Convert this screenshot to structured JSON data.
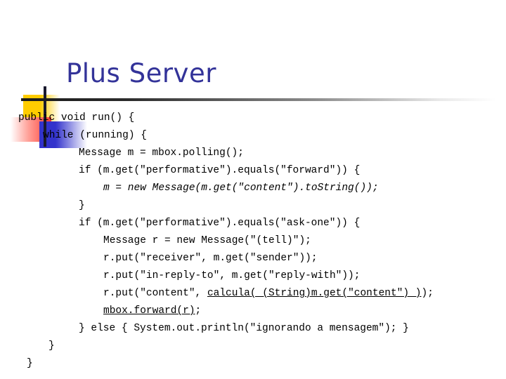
{
  "slide": {
    "title": "Plus Server",
    "title_color": "#333399",
    "background_color": "#ffffff",
    "decoration": {
      "yellow_color": "#FFCC00",
      "blue_color": "#3333CC",
      "red_color": "#FF3B30",
      "line_color": "#1a1a2e"
    }
  },
  "code": {
    "language": "java",
    "lines": [
      {
        "indent": "i0",
        "style": "normal",
        "text": "public void run() {"
      },
      {
        "indent": "i1",
        "style": "normal",
        "text": "while (running) {"
      },
      {
        "indent": "i2",
        "style": "normal",
        "text": "Message m = mbox.polling();"
      },
      {
        "indent": "i2",
        "style": "normal",
        "text": "if (m.get(\"performative\").equals(\"forward\")) {"
      },
      {
        "indent": "i3",
        "style": "italic",
        "text": "m = new Message(m.get(\"content\").toString());"
      },
      {
        "indent": "i2",
        "style": "normal",
        "text": "}"
      },
      {
        "indent": "i2",
        "style": "normal",
        "text": "if (m.get(\"performative\").equals(\"ask-one\")) {"
      },
      {
        "indent": "i3",
        "style": "normal",
        "text": "Message r = new Message(\"(tell)\");"
      },
      {
        "indent": "i3",
        "style": "normal",
        "text": "r.put(\"receiver\", m.get(\"sender\"));"
      },
      {
        "indent": "i3",
        "style": "normal",
        "text": "r.put(\"in-reply-to\", m.get(\"reply-with\"));"
      },
      {
        "indent": "i3",
        "style": "underline-partial",
        "text": "r.put(\"content\", ",
        "underlined": "calcula( (String)m.get(\"content\") )",
        "tail": ");"
      },
      {
        "indent": "i3",
        "style": "underline-full",
        "underlined": "mbox.forward(r)",
        "tail": ";"
      },
      {
        "indent": "i5",
        "style": "normal",
        "text": "} else { System.out.println(\"ignorando a mensagem\"); }"
      },
      {
        "indent": "i6",
        "style": "normal",
        "text": "}"
      },
      {
        "indent": "i7",
        "style": "normal",
        "text": "}"
      }
    ]
  }
}
